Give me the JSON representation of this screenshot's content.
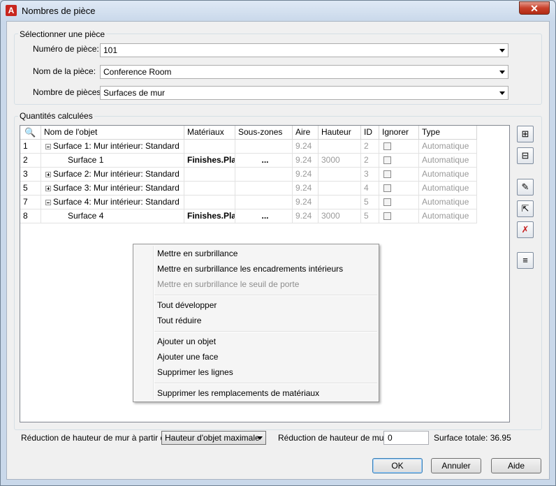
{
  "window": {
    "title": "Nombres de pièce",
    "close_glyph": "✕",
    "app_icon": "A"
  },
  "select_group": {
    "title": "Sélectionner une pièce",
    "number_label": "Numéro de pièce:",
    "number_value": "101",
    "name_label": "Nom de la pièce:",
    "name_value": "Conference Room",
    "count_label": "Nombre de pièces:",
    "count_value": "Surfaces de mur"
  },
  "calc_group": {
    "title": "Quantités calculées"
  },
  "grid": {
    "search_glyph": "🔍",
    "headers": {
      "name": "Nom de l'objet",
      "materials": "Matériaux",
      "subzones": "Sous-zones",
      "area": "Aire",
      "height": "Hauteur",
      "id": "ID",
      "ignore": "Ignorer",
      "type": "Type"
    },
    "rows": [
      {
        "num": "1",
        "name": "Surface 1: Mur intérieur: Standard",
        "materials": "",
        "subzones": "",
        "area": "9.24",
        "height": "",
        "id": "2",
        "type": "Automatique"
      },
      {
        "num": "2",
        "name": "Surface 1",
        "materials": "Finishes.Plas",
        "subzones": "...",
        "area": "9.24",
        "height": "3000",
        "id": "2",
        "type": "Automatique"
      },
      {
        "num": "3",
        "name": "Surface 2: Mur intérieur: Standard",
        "materials": "",
        "subzones": "",
        "area": "9.24",
        "height": "",
        "id": "3",
        "type": "Automatique"
      },
      {
        "num": "5",
        "name": "Surface 3: Mur intérieur: Standard",
        "materials": "",
        "subzones": "",
        "area": "9.24",
        "height": "",
        "id": "4",
        "type": "Automatique"
      },
      {
        "num": "7",
        "name": "Surface 4: Mur intérieur: Standard",
        "materials": "",
        "subzones": "",
        "area": "9.24",
        "height": "",
        "id": "5",
        "type": "Automatique"
      },
      {
        "num": "8",
        "name": "Surface 4",
        "materials": "Finishes.Plas",
        "subzones": "...",
        "area": "9.24",
        "height": "3000",
        "id": "5",
        "type": "Automatique"
      }
    ]
  },
  "side_buttons": {
    "expand_all_glyph": "⊞",
    "collapse_all_glyph": "⊟",
    "highlight_glyph": "✎",
    "select_glyph": "⇱",
    "delete_glyph": "✗",
    "export_glyph": "≡"
  },
  "context_menu": {
    "items": [
      "Mettre en surbrillance",
      "Mettre en surbrillance les encadrements intérieurs",
      "Mettre en surbrillance le seuil de porte",
      "Tout développer",
      "Tout réduire",
      "Ajouter un objet",
      "Ajouter une face",
      "Supprimer les lignes",
      "Supprimer les remplacements de matériaux"
    ]
  },
  "bottom": {
    "reduction_from_label": "Réduction de hauteur de mur à partir de",
    "reduction_from_value": "Hauteur d'objet maximale",
    "reduction_label": "Réduction de hauteur de mur",
    "reduction_value": "0",
    "total_label": "Surface totale: 36.95"
  },
  "buttons": {
    "ok": "OK",
    "cancel": "Annuler",
    "help": "Aide"
  }
}
